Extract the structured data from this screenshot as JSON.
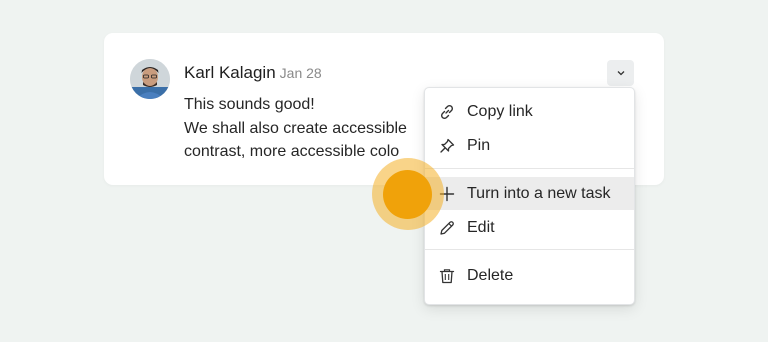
{
  "comment": {
    "author": "Karl Kalagin",
    "date": "Jan 28",
    "lines": [
      "This sounds good!",
      "We shall also create accessible",
      "contrast, more accessible colo"
    ]
  },
  "menu": {
    "items": [
      {
        "label": "Copy link",
        "icon": "link-icon"
      },
      {
        "label": "Pin",
        "icon": "pin-icon"
      },
      {
        "label": "Turn into a new task",
        "icon": "plus-icon"
      },
      {
        "label": "Edit",
        "icon": "pencil-icon"
      },
      {
        "label": "Delete",
        "icon": "trash-icon"
      }
    ]
  },
  "colors": {
    "background": "#eff3f1",
    "card": "#ffffff",
    "hover": "#ececec",
    "cursor": "#f0a20a"
  }
}
